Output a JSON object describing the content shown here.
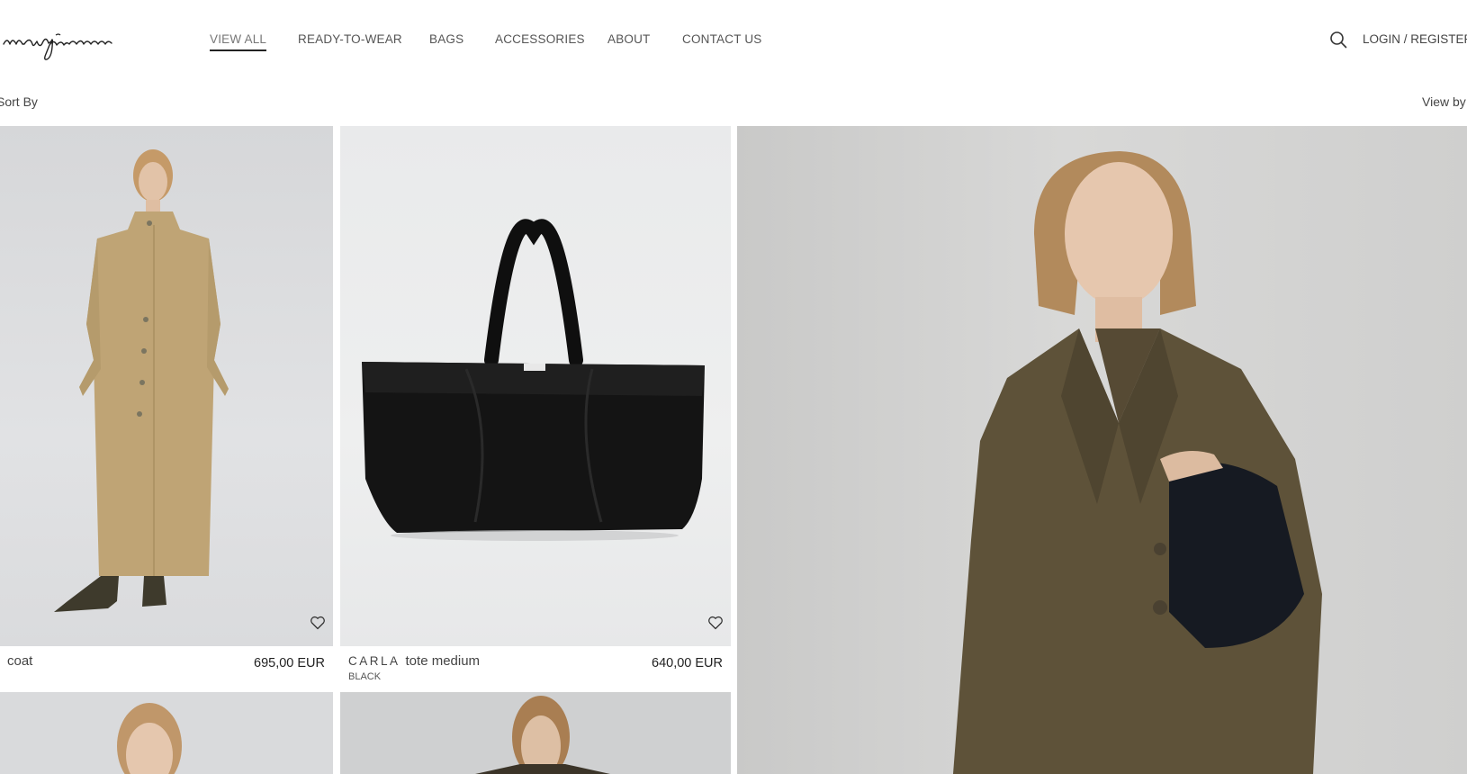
{
  "brand": {
    "logo_text": "manjorou"
  },
  "nav": {
    "items": [
      {
        "label": "VIEW ALL",
        "active": true
      },
      {
        "label": "READY-TO-WEAR",
        "active": false
      },
      {
        "label": "BAGS",
        "active": false
      },
      {
        "label": "ACCESSORIES",
        "active": false
      },
      {
        "label": "ABOUT",
        "active": false
      },
      {
        "label": "CONTACT US",
        "active": false
      }
    ]
  },
  "header": {
    "search_icon": "search-icon",
    "login_label": "LOGIN / REGISTER"
  },
  "toolbar": {
    "sort_label": "Sort By",
    "view_label": "View by"
  },
  "products": [
    {
      "name": "coat",
      "brand": "",
      "color": "",
      "price": "695,00 EUR",
      "image": "beige-sleeveless-coat-model"
    },
    {
      "name": "tote medium",
      "brand": "CARLA",
      "color": "BLACK",
      "price": "640,00 EUR",
      "image": "black-pony-hair-tote-bag"
    }
  ],
  "hero": {
    "image": "model-olive-tweed-blazer-with-black-bag"
  },
  "colors": {
    "text": "#333333",
    "nav": "#555555",
    "underline": "#222222",
    "bg": "#ffffff"
  }
}
